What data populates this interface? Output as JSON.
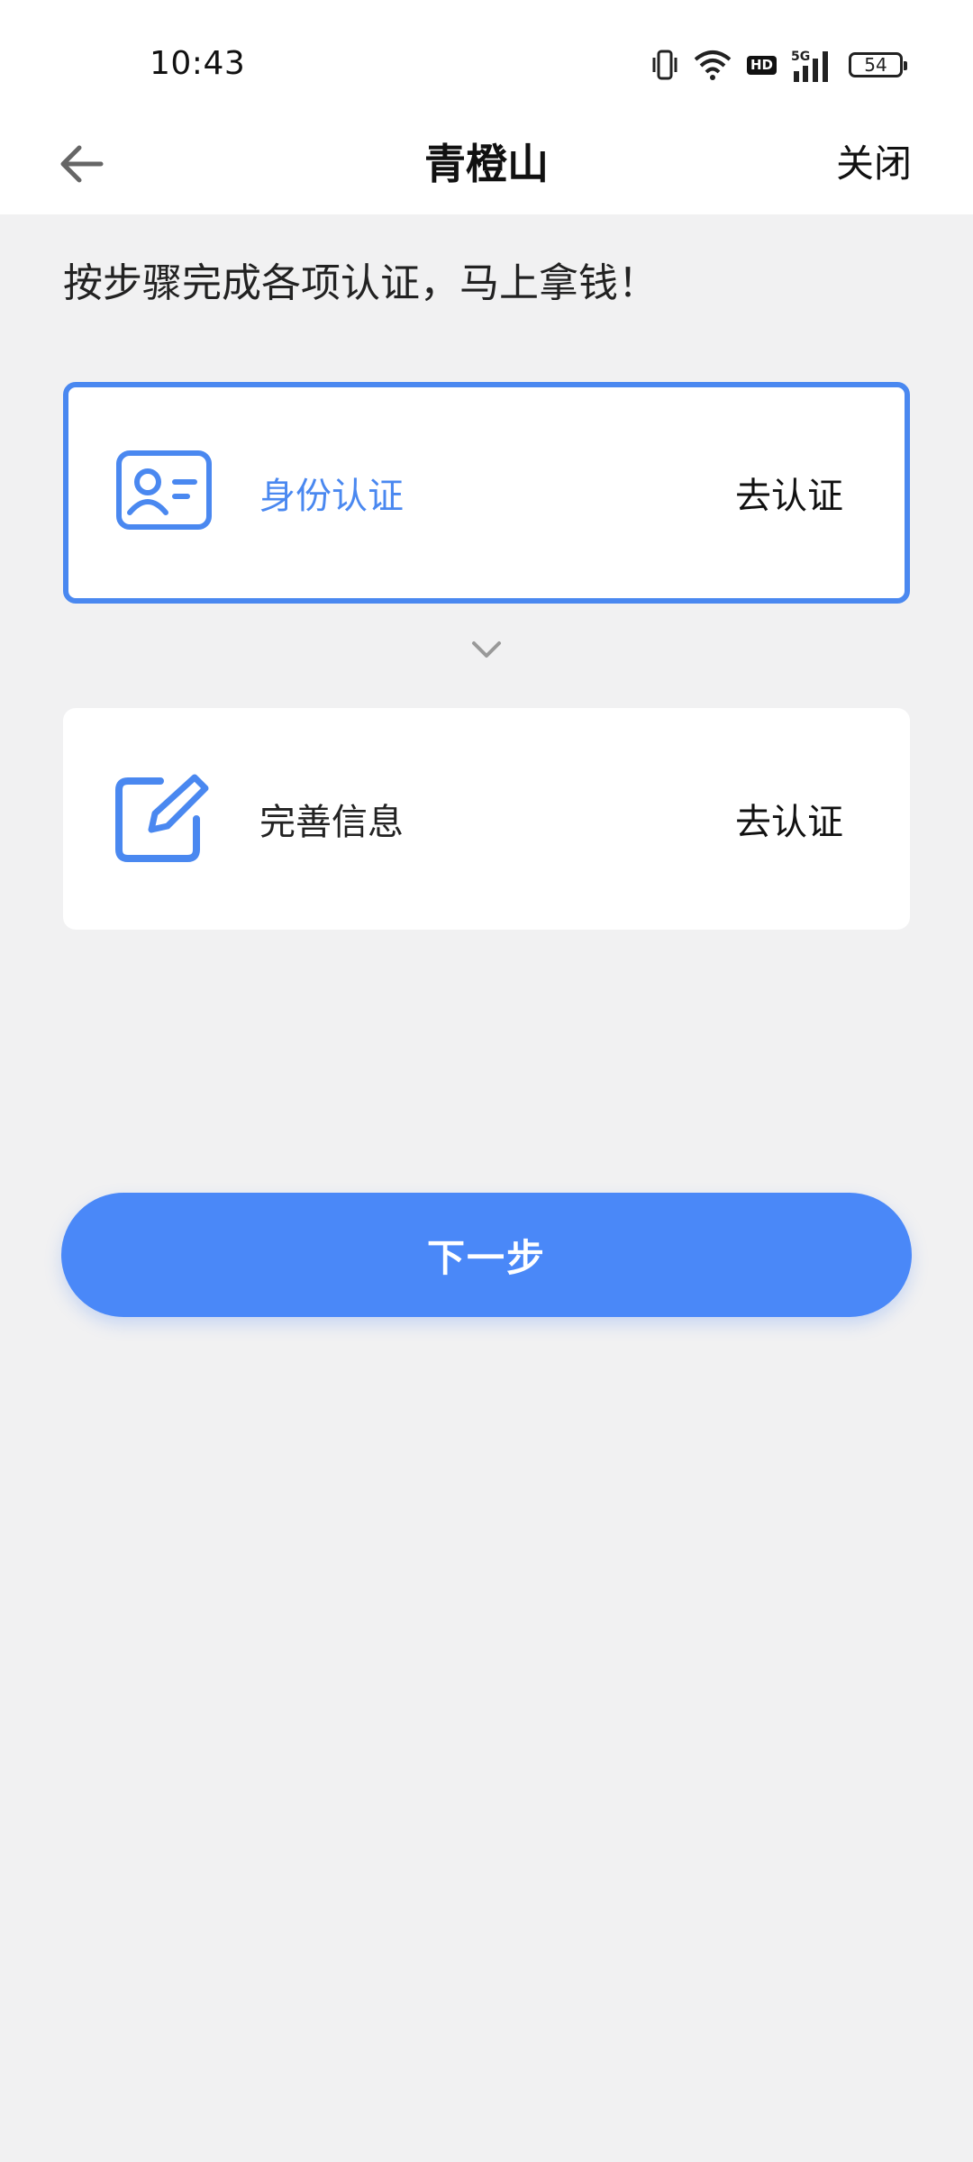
{
  "status_bar": {
    "time": "10:43",
    "hd_label": "HD",
    "network_label": "5G",
    "battery_level": "54"
  },
  "header": {
    "title": "青橙山",
    "close_label": "关闭"
  },
  "instructions": "按步骤完成各项认证，马上拿钱！",
  "steps": [
    {
      "label": "身份认证",
      "action": "去认证",
      "icon": "id-card-icon",
      "state": "active"
    },
    {
      "label": "完善信息",
      "action": "去认证",
      "icon": "edit-icon",
      "state": "inactive"
    }
  ],
  "next_button_label": "下一步",
  "colors": {
    "accent": "#4a88f0",
    "button": "#4a88f8",
    "background": "#f1f1f2"
  }
}
